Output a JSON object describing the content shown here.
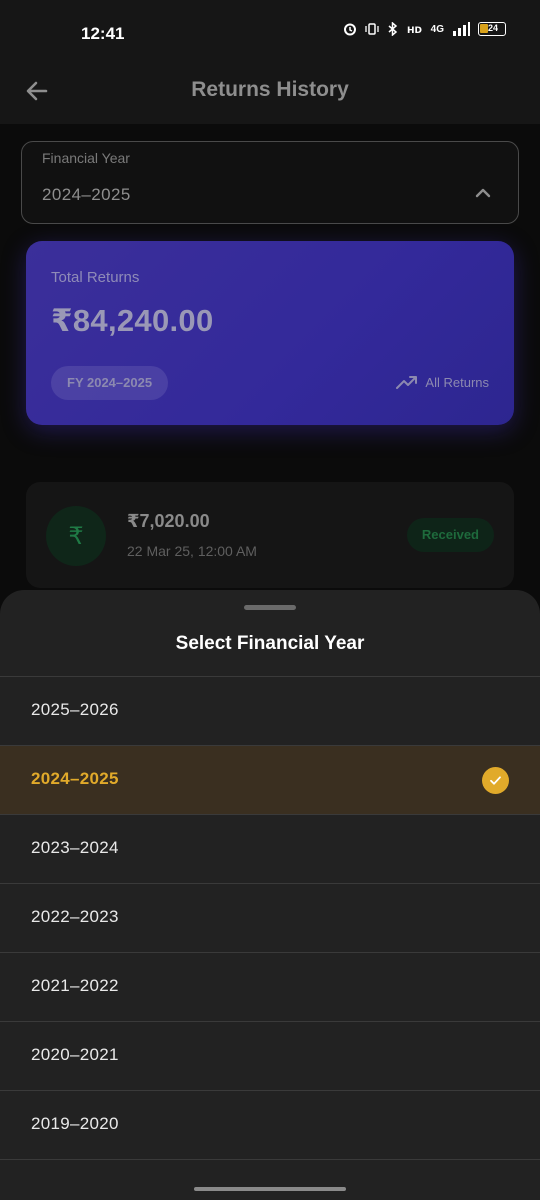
{
  "status_bar": {
    "time": "12:41",
    "battery_level": "24",
    "network_label": "4G"
  },
  "header": {
    "title": "Returns History"
  },
  "filter": {
    "label": "Financial Year",
    "value": "2024–2025"
  },
  "summary": {
    "label": "Total Returns",
    "amount": "₹84,240.00",
    "fy_chip": "FY 2024–2025",
    "all_returns_label": "All Returns"
  },
  "transactions": [
    {
      "amount": "₹7,020.00",
      "date": "22 Mar 25, 12:00 AM",
      "status": "Received",
      "icon": "₹"
    }
  ],
  "sheet": {
    "title": "Select Financial Year",
    "years": [
      "2025–2026",
      "2024–2025",
      "2023–2024",
      "2022–2023",
      "2021–2022",
      "2020–2021",
      "2019–2020"
    ],
    "selected_index": 1
  },
  "colors": {
    "accent": "#e1aa2a",
    "card_purple": "#3b2f9a",
    "status_green": "#1e6a3c"
  }
}
